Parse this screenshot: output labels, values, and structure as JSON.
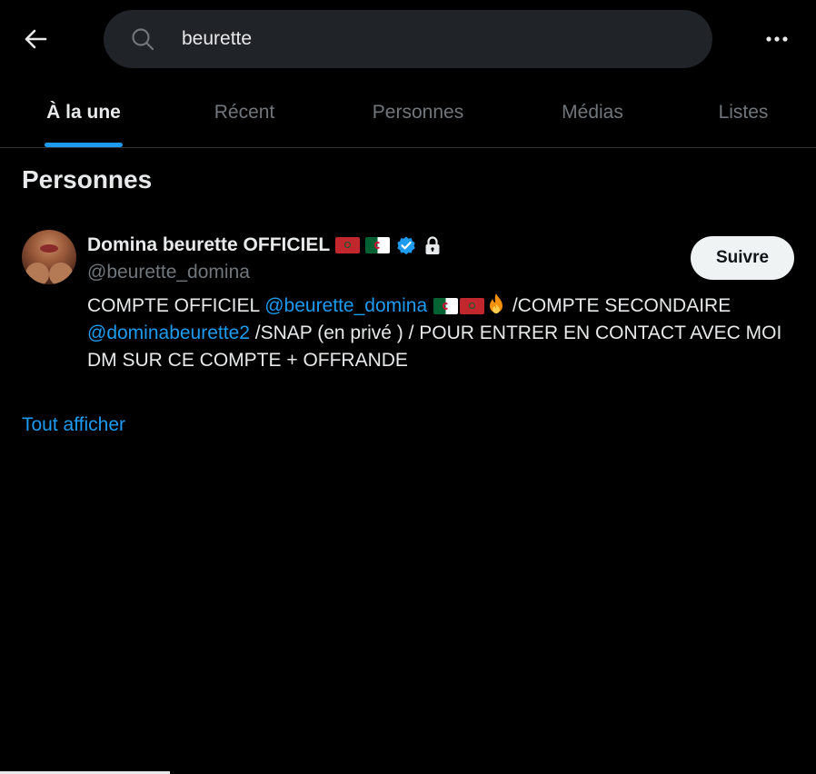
{
  "header": {
    "back_icon": "arrow-left-icon",
    "search_icon": "search-icon",
    "search_value": "beurette",
    "more_icon": "more-horizontal-icon"
  },
  "tabs": [
    {
      "label": "À la une",
      "active": true
    },
    {
      "label": "Récent",
      "active": false
    },
    {
      "label": "Personnes",
      "active": false
    },
    {
      "label": "Médias",
      "active": false
    },
    {
      "label": "Listes",
      "active": false
    }
  ],
  "section": {
    "title": "Personnes"
  },
  "user": {
    "display_name": "Domina beurette OFFICIEL",
    "badges": [
      "morocco-flag-icon",
      "algeria-flag-icon",
      "verified-badge-icon",
      "lock-icon"
    ],
    "handle": "@beurette_domina",
    "follow_label": "Suivre",
    "bio": {
      "part1": "COMPTE OFFICIEL ",
      "mention1": "@beurette_domina",
      "part2": " /COMPTE SECONDAIRE ",
      "mention2": "@dominabeurette2",
      "part3": " /SNAP (en privé ) / POUR ENTRER EN CONTACT AVEC MOI DM SUR CE COMPTE + OFFRANDE"
    }
  },
  "show_all_label": "Tout afficher",
  "colors": {
    "background": "#000000",
    "text": "#e7e9ea",
    "muted": "#71767b",
    "accent": "#1d9bf0",
    "search_bg": "#202327"
  }
}
